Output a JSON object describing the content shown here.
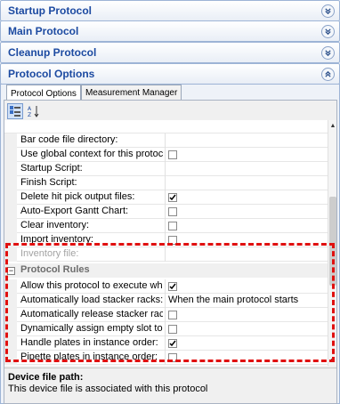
{
  "panels": [
    {
      "title": "Startup Protocol",
      "state": "collapsed"
    },
    {
      "title": "Main Protocol",
      "state": "collapsed"
    },
    {
      "title": "Cleanup Protocol",
      "state": "collapsed"
    },
    {
      "title": "Protocol Options",
      "state": "expanded"
    }
  ],
  "tabs": [
    "Protocol Options",
    "Measurement Manager"
  ],
  "toolbar": {
    "categorized": "categorized-view-icon",
    "alphabetical": "alphabetical-sort-icon"
  },
  "properties": [
    {
      "label": "Bar code file directory:",
      "type": "text",
      "value": ""
    },
    {
      "label": "Use global context for this protocol:",
      "type": "checkbox",
      "checked": false
    },
    {
      "label": "Startup Script:",
      "type": "text",
      "value": ""
    },
    {
      "label": "Finish Script:",
      "type": "text",
      "value": ""
    },
    {
      "label": "Delete hit pick output files:",
      "type": "checkbox",
      "checked": true
    },
    {
      "label": "Auto-Export Gantt Chart:",
      "type": "checkbox",
      "checked": false
    },
    {
      "label": "Clear inventory:",
      "type": "checkbox",
      "checked": false
    },
    {
      "label": "Import inventory:",
      "type": "checkbox",
      "checked": false
    },
    {
      "label": "Inventory file:",
      "type": "text",
      "value": "",
      "disabled": true
    }
  ],
  "category": {
    "label": "Protocol Rules",
    "expander": "⊟"
  },
  "rules": [
    {
      "label": "Allow this protocol to execute while",
      "type": "checkbox",
      "checked": true
    },
    {
      "label": "Automatically load stacker racks:",
      "type": "text",
      "value": "When the main protocol starts"
    },
    {
      "label": "Automatically release stacker racks af",
      "type": "checkbox",
      "checked": false
    },
    {
      "label": "Dynamically assign empty slot to load",
      "type": "checkbox",
      "checked": false
    },
    {
      "label": "Handle plates in instance order:",
      "type": "checkbox",
      "checked": true
    },
    {
      "label": "Pipette plates in instance order:",
      "type": "checkbox",
      "checked": false
    }
  ],
  "description": {
    "title": "Device file path:",
    "text": "This device file is associated with this protocol"
  },
  "colors": {
    "panel_title": "#1c4aa1",
    "highlight": "#e01010",
    "category": "#6d6d6d"
  }
}
